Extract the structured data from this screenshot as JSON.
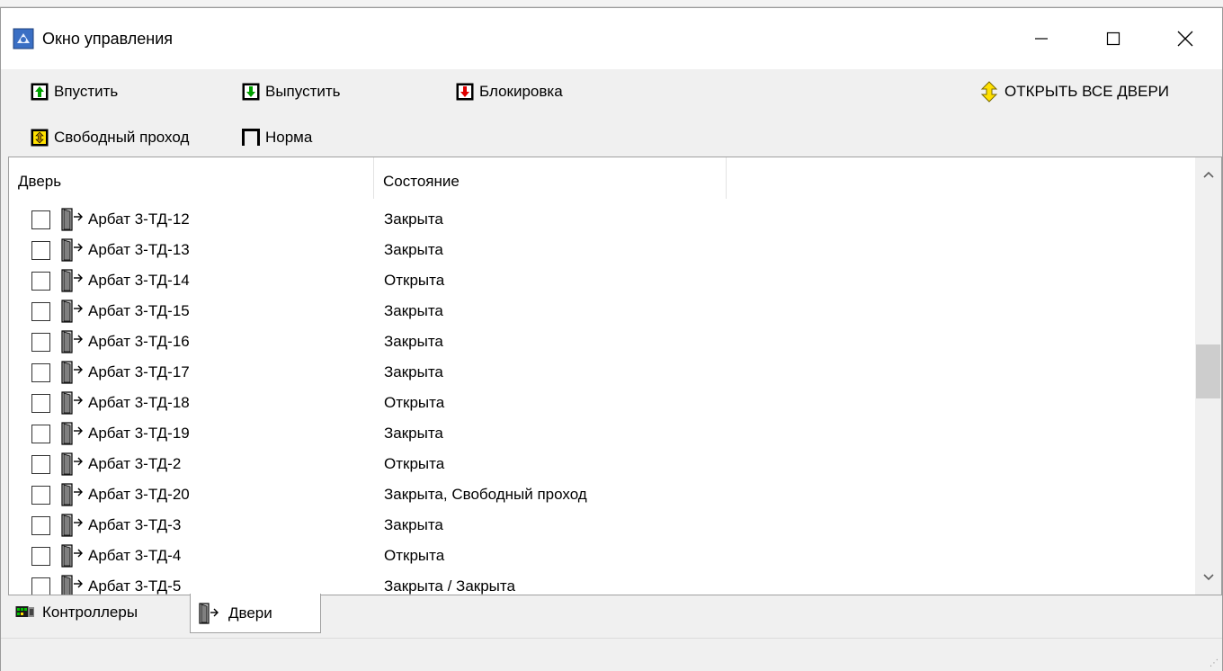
{
  "window": {
    "title": "Окно управления",
    "controls": {
      "minimize": "—",
      "maximize": "☐",
      "close": "✕"
    }
  },
  "toolbar": {
    "let_in": "Впустить",
    "let_out": "Выпустить",
    "block": "Блокировка",
    "open_all": "ОТКРЫТЬ ВСЕ ДВЕРИ",
    "free_pass": "Свободный проход",
    "normal": "Норма"
  },
  "list": {
    "columns": [
      "Дверь",
      "Состояние",
      ""
    ],
    "rows": [
      {
        "door": "Арбат 3-ТД-12",
        "state": "Закрыта"
      },
      {
        "door": "Арбат 3-ТД-13",
        "state": "Закрыта"
      },
      {
        "door": "Арбат 3-ТД-14",
        "state": "Открыта"
      },
      {
        "door": "Арбат 3-ТД-15",
        "state": "Закрыта"
      },
      {
        "door": "Арбат 3-ТД-16",
        "state": "Закрыта"
      },
      {
        "door": "Арбат 3-ТД-17",
        "state": "Закрыта"
      },
      {
        "door": "Арбат 3-ТД-18",
        "state": "Открыта"
      },
      {
        "door": "Арбат 3-ТД-19",
        "state": "Закрыта"
      },
      {
        "door": "Арбат 3-ТД-2",
        "state": "Открыта"
      },
      {
        "door": "Арбат 3-ТД-20",
        "state": "Закрыта, Свободный проход"
      },
      {
        "door": "Арбат 3-ТД-3",
        "state": "Закрыта"
      },
      {
        "door": "Арбат 3-ТД-4",
        "state": "Открыта"
      },
      {
        "door": "Арбат 3-ТД-5",
        "state": "Закрыта / Закрыта"
      }
    ]
  },
  "tabs": [
    {
      "label": "Контроллеры",
      "icon": "controller-icon",
      "active": false
    },
    {
      "label": "Двери",
      "icon": "door-icon",
      "active": true
    }
  ],
  "colors": {
    "arrow_green": "#00a000",
    "arrow_red": "#e00000",
    "arrow_yellow": "#ffe000",
    "titlebar_bg": "#ffffff",
    "window_bg": "#f0f0f0"
  }
}
